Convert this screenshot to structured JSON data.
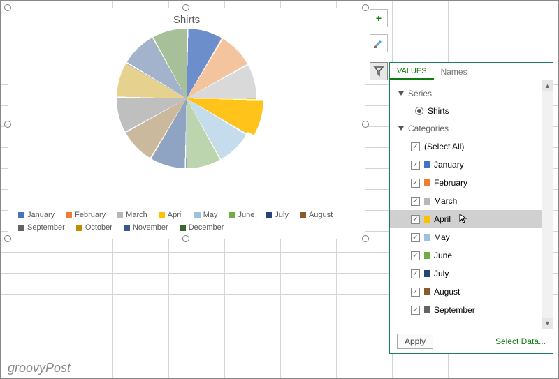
{
  "chart_data": {
    "type": "pie",
    "title": "Shirts",
    "categories": [
      "January",
      "February",
      "March",
      "April",
      "May",
      "June",
      "July",
      "August",
      "September",
      "October",
      "November",
      "December"
    ],
    "values": [
      8.3,
      8.3,
      8.3,
      8.3,
      8.3,
      8.3,
      8.3,
      8.3,
      8.3,
      8.3,
      8.3,
      8.3
    ],
    "pulled_slice": "April",
    "series": [
      {
        "name": "Shirts",
        "values": [
          8.3,
          8.3,
          8.3,
          8.3,
          8.3,
          8.3,
          8.3,
          8.3,
          8.3,
          8.3,
          8.3,
          8.3
        ]
      }
    ],
    "legend_position": "bottom",
    "colors": {
      "January": "#4472c4",
      "February": "#ed7d31",
      "March": "#b7b7b7",
      "April": "#ffc000",
      "May": "#9ec1e0",
      "June": "#70ad47",
      "July": "#264478",
      "August": "#8b5a2b",
      "September": "#636363",
      "October": "#bf8f00",
      "November": "#365a8f",
      "December": "#3b6631"
    },
    "pastels": {
      "January": "#6c8ecb",
      "February": "#f4c49f",
      "March": "#d9d9d9",
      "April": "#ffc319",
      "May": "#c5dcec",
      "June": "#bcd5ae",
      "July": "#8fa4c3",
      "August": "#cbb99d",
      "September": "#bfbfbf",
      "October": "#e6d28e",
      "November": "#a3b3cc",
      "December": "#a7c09a"
    }
  },
  "filter_panel": {
    "tabs": {
      "values": "Values",
      "names": "Names"
    },
    "series_group": "Series",
    "series_option": "Shirts",
    "categories_group": "Categories",
    "select_all": "(Select All)",
    "hovered_item": "April",
    "apply": "Apply",
    "select_data": "Select Data..."
  },
  "watermark": "groovyPost"
}
